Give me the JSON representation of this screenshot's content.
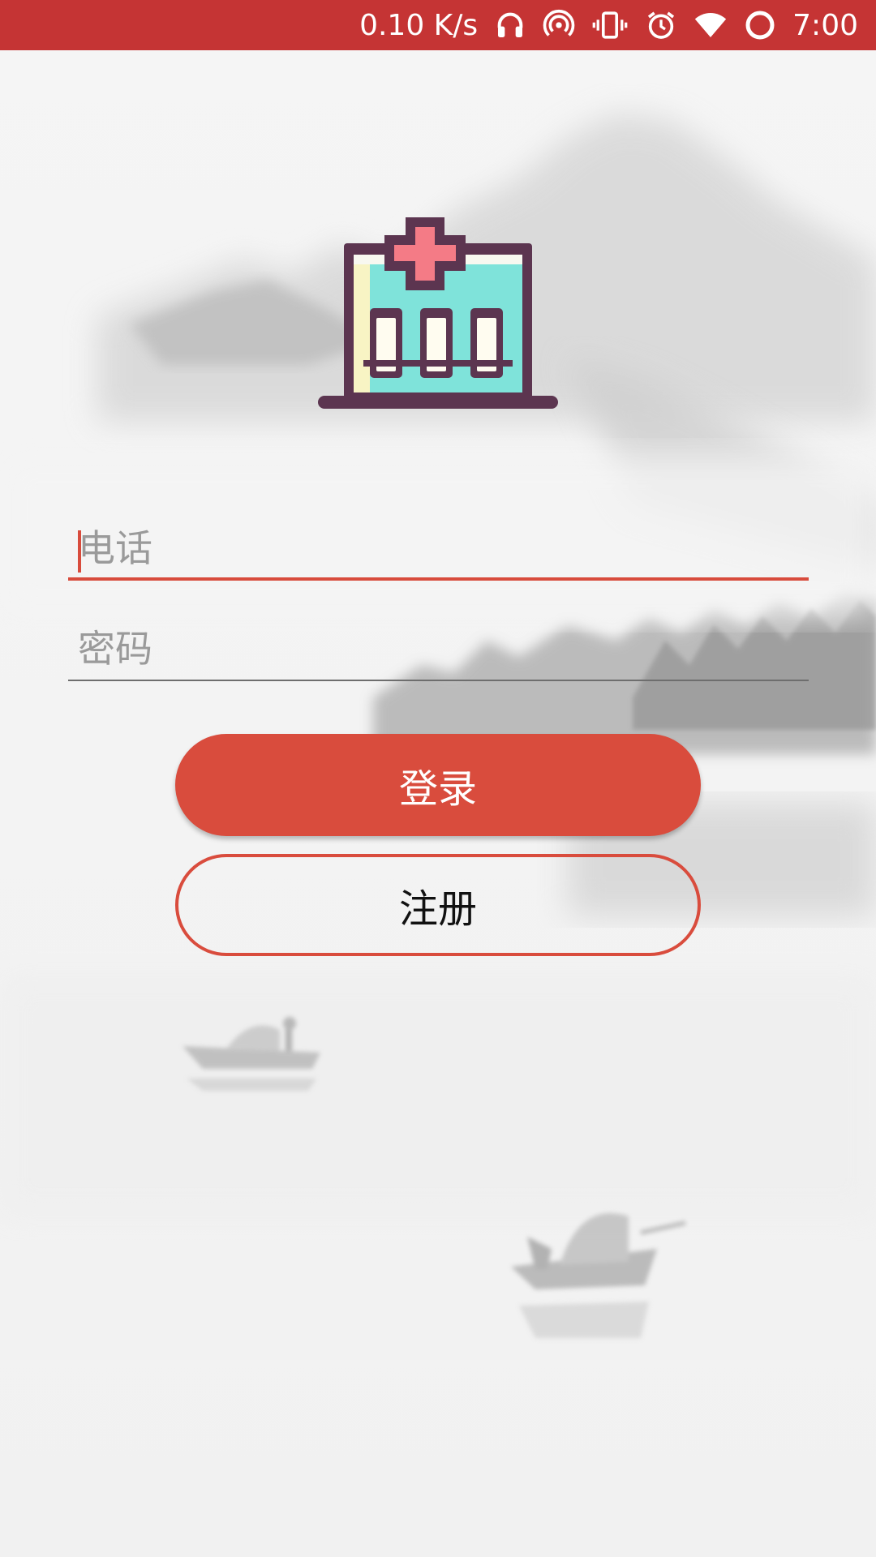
{
  "status_bar": {
    "net_speed": "0.10 K/s",
    "time": "7:00",
    "icons": [
      "headphones-icon",
      "hotspot-icon",
      "vibrate-icon",
      "alarm-icon",
      "wifi-icon",
      "battery-icon"
    ]
  },
  "logo": {
    "icon": "hospital-icon"
  },
  "form": {
    "phone_placeholder": "电话",
    "password_placeholder": "密码"
  },
  "buttons": {
    "login_label": "登录",
    "register_label": "注册"
  },
  "colors": {
    "accent": "#d94c3d",
    "status_bar": "#c53434"
  }
}
